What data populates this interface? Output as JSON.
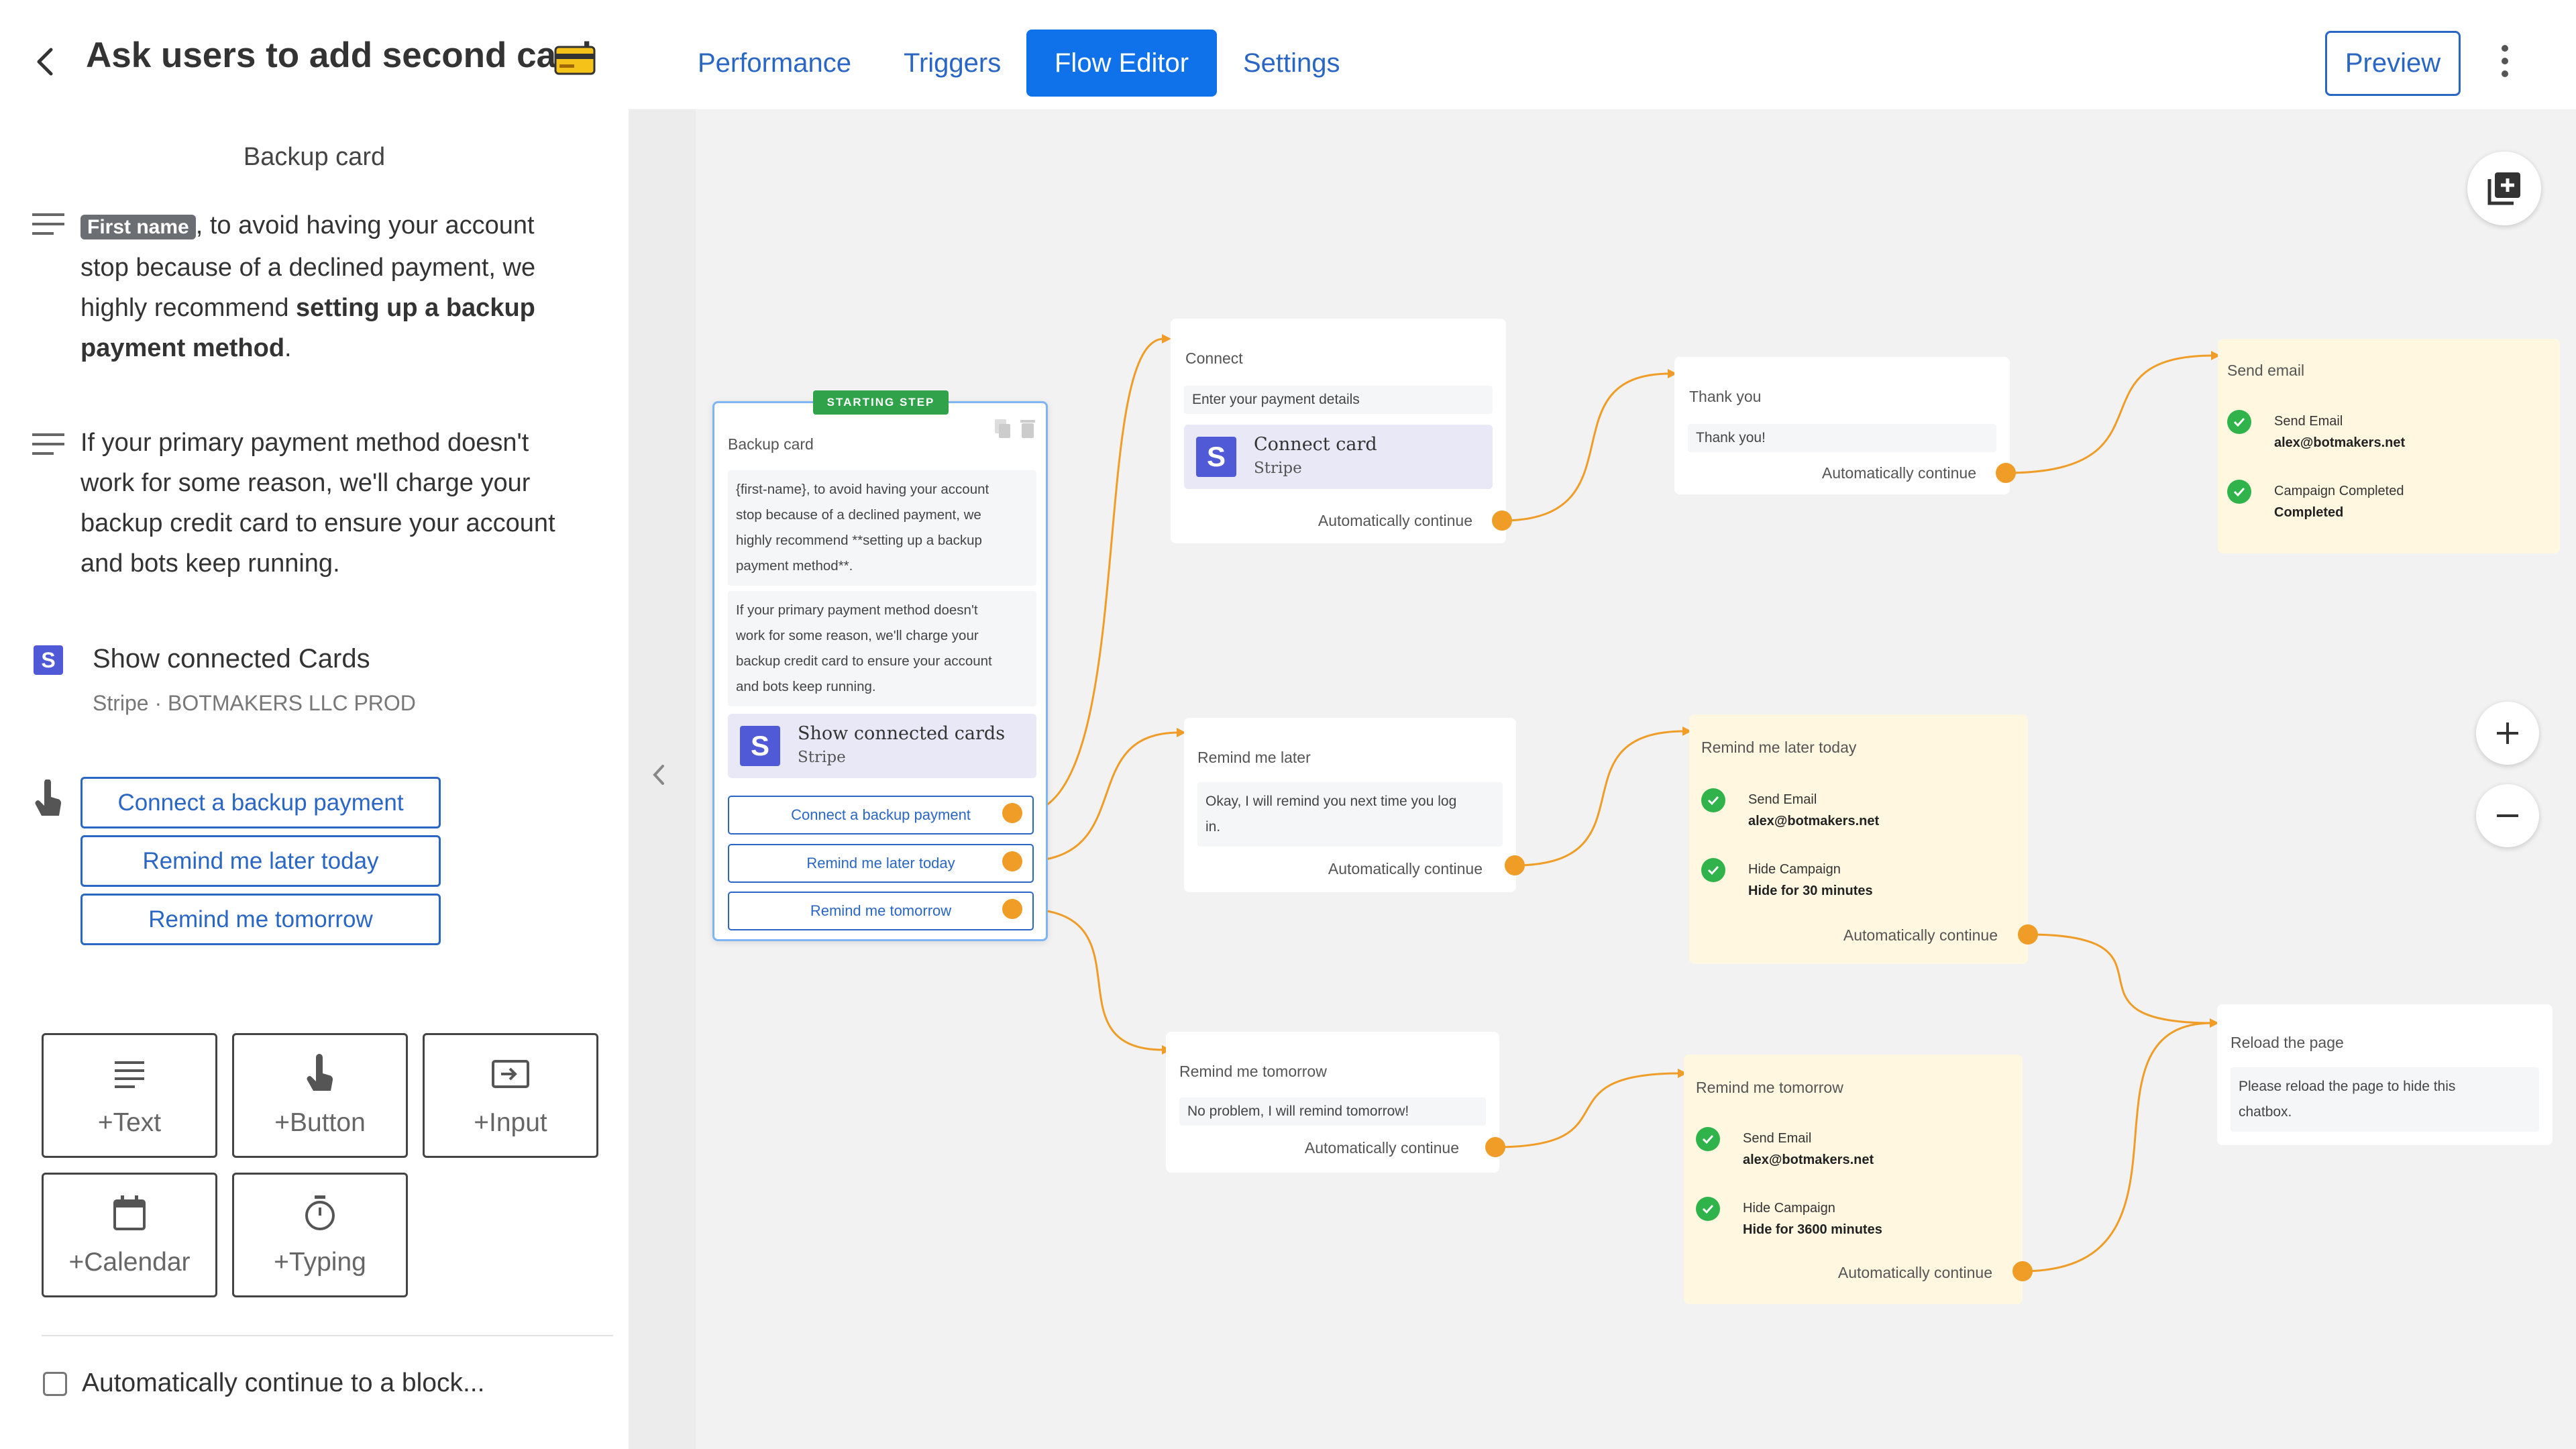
{
  "header": {
    "title": "Ask users to add second card",
    "tabs": [
      {
        "label": "Performance",
        "active": false
      },
      {
        "label": "Triggers",
        "active": false
      },
      {
        "label": "Flow Editor",
        "active": true
      },
      {
        "label": "Settings",
        "active": false
      }
    ],
    "preview_label": "Preview"
  },
  "left_panel": {
    "title": "Backup card",
    "text1": {
      "tag": "First name",
      "part1": ", to avoid having your account",
      "line2": "stop because of a declined payment, we",
      "line3_start": "highly recommend ",
      "line3_bold": "setting up a backup",
      "line4_bold": "payment method",
      "line4_end": "."
    },
    "text2": [
      "If your primary payment method doesn't",
      "work for some reason, we'll charge your",
      "backup credit card to ensure your account",
      "and bots keep running."
    ],
    "integration": {
      "name": "Show connected Cards",
      "sub": "Stripe · BOTMAKERS LLC PROD"
    },
    "buttons": [
      "Connect a backup payment",
      "Remind me later today",
      "Remind me tomorrow"
    ],
    "blocks": [
      "+Text",
      "+Button",
      "+Input",
      "+Calendar",
      "+Typing"
    ],
    "auto_continue": "Automatically continue to a block..."
  },
  "canvas": {
    "starting_badge": "STARTING STEP",
    "nodes": {
      "backup": {
        "title": "Backup card",
        "text1": [
          "{first-name}, to avoid having your account",
          "stop because of a declined payment, we",
          "highly recommend **setting up a backup",
          "payment method**."
        ],
        "text2": [
          "If your primary payment method doesn't",
          "work for some reason, we'll charge your",
          "backup credit card to ensure your account",
          "and bots keep running."
        ],
        "stripe_title": "Show connected cards",
        "stripe_sub": "Stripe",
        "buttons": [
          "Connect a backup payment",
          "Remind me later today",
          "Remind me tomorrow"
        ]
      },
      "connect": {
        "title": "Connect",
        "field": "Enter your payment details",
        "stripe_title": "Connect card",
        "stripe_sub": "Stripe",
        "auto": "Automatically continue"
      },
      "thank_you": {
        "title": "Thank you",
        "field": "Thank you!",
        "auto": "Automatically continue"
      },
      "send_email": {
        "title": "Send email",
        "a1_label": "Send Email",
        "a1_value": "alex@botmakers.net",
        "a2_label": "Campaign Completed",
        "a2_value": "Completed"
      },
      "remind_later": {
        "title": "Remind me later",
        "field": [
          "Okay, I will remind you next time you log",
          "in."
        ],
        "auto": "Automatically continue"
      },
      "remind_later_today": {
        "title": "Remind me later today",
        "a1_label": "Send Email",
        "a1_value": "alex@botmakers.net",
        "a2_label": "Hide Campaign",
        "a2_value": "Hide for 30 minutes",
        "auto": "Automatically continue"
      },
      "remind_tomorrow": {
        "title": "Remind me tomorrow",
        "field": "No problem, I will remind tomorrow!",
        "auto": "Automatically continue"
      },
      "remind_tomorrow_y": {
        "title": "Remind me tomorrow",
        "a1_label": "Send Email",
        "a1_value": "alex@botmakers.net",
        "a2_label": "Hide Campaign",
        "a2_value": "Hide for 3600 minutes",
        "auto": "Automatically continue"
      },
      "reload": {
        "title": "Reload the page",
        "field": [
          "Please reload the page to hide this",
          "chatbox."
        ]
      }
    }
  },
  "colors": {
    "accent": "#0f72ea",
    "link": "#2a66c4",
    "connector": "#ef9d27",
    "action_bg": "#fff7e0",
    "check": "#2fb34a",
    "stripe": "#5059d6"
  },
  "icons": [
    "back-arrow-icon",
    "credit-card-icon",
    "kebab-menu-icon",
    "text-lines-icon",
    "stripe-icon",
    "pointer-hand-icon",
    "input-icon",
    "calendar-icon",
    "timer-icon",
    "add-block-icon",
    "zoom-in-icon",
    "zoom-out-icon",
    "collapse-arrow-icon",
    "copy-icon",
    "trash-icon",
    "check-circle-icon"
  ]
}
